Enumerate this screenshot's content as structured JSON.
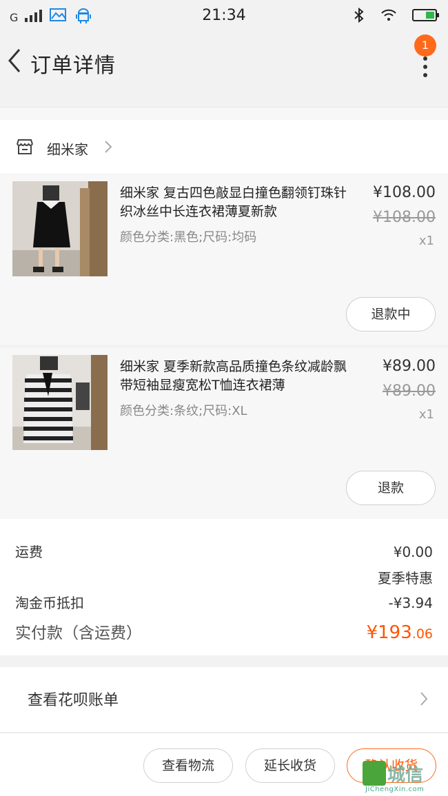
{
  "status_bar": {
    "carrier": "G",
    "time": "21:34"
  },
  "nav": {
    "title": "订单详情",
    "badge_count": "1"
  },
  "shop": {
    "name": "细米家"
  },
  "items": [
    {
      "title": "细米家 复古四色敲显白撞色翻领钉珠针织冰丝中长连衣裙薄夏新款",
      "spec": "颜色分类:黑色;尺码:均码",
      "price": "¥108.00",
      "original_price": "¥108.00",
      "quantity": "x1",
      "action_label": "退款中"
    },
    {
      "title": "细米家 夏季新款高品质撞色条纹减龄飘带短袖显瘦宽松T恤连衣裙薄",
      "spec": "颜色分类:条纹;尺码:XL",
      "price": "¥89.00",
      "original_price": "¥89.00",
      "quantity": "x1",
      "action_label": "退款"
    }
  ],
  "summary": {
    "shipping_label": "运费",
    "shipping_value": "¥0.00",
    "promo_label": "夏季特惠",
    "coin_label": "淘金币抵扣",
    "coin_value": "-¥3.94",
    "total_label": "实付款（含运费）",
    "total_currency": "¥",
    "total_main": "193",
    "total_cents": ".06"
  },
  "huabei": {
    "label": "查看花呗账单"
  },
  "bottom_bar": {
    "logistics_label": "查看物流",
    "extend_label": "延长收货",
    "confirm_label": "确认收货"
  },
  "watermark": {
    "text": "城信",
    "url": "JiChengXin.com"
  },
  "colors": {
    "accent": "#ff5500",
    "badge": "#ff6a1a",
    "battery": "#2fb74a",
    "app_icons": "#1e88e5"
  }
}
